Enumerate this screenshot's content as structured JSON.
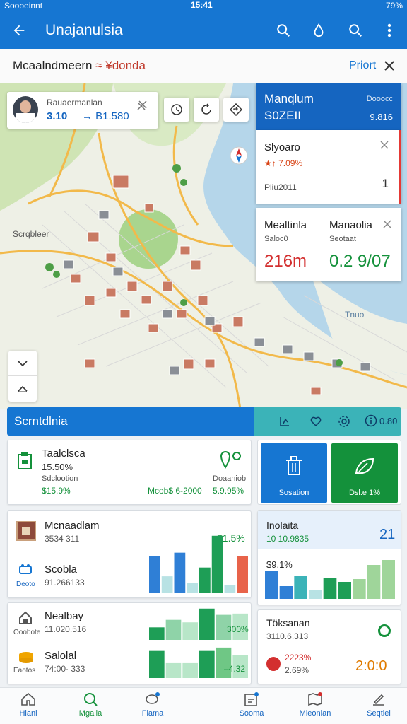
{
  "status": {
    "carrier": "Soooeinnt",
    "time": "15:41",
    "battery": "79%"
  },
  "appbar": {
    "title": "Unajanulsia"
  },
  "route": {
    "title": "Mcaalndmeern",
    "subtitle": "≈ ¥donda",
    "print_label": "Priort"
  },
  "profile": {
    "name": "Rauaermanlan",
    "stat_a": "3.10",
    "stat_b": "→ B1.580"
  },
  "info_header": {
    "title": "Manqlum",
    "sub": "S0ZEII",
    "right1": "Dooocc",
    "right2": "9.816"
  },
  "info_item1": {
    "title": "Slyoaro",
    "trend": "★↑ 7.09%",
    "desc": "Pliu2011",
    "count": "1"
  },
  "info_item2": {
    "label1": "Mealtinla",
    "label2": "Manaolia",
    "sub1": "Saloc0",
    "sub2": "Seotaat",
    "value1": "216m",
    "value2": "0.2 9/07"
  },
  "map_labels": {
    "town": "Scrqbleer",
    "water": "Tnuo"
  },
  "section": {
    "title": "Scrntdlnia",
    "icon_value": "0.80"
  },
  "card1": {
    "title": "Taalclsca",
    "pct": "15.50%",
    "sub": "Sdclootion",
    "sub2": "Doaaniob",
    "val1": "$15.9%",
    "val2": "Mcob$ 6-2000",
    "val3": "5.9.95%"
  },
  "action1": {
    "label": "Sosation"
  },
  "action2": {
    "label": "Dsl.e 1%"
  },
  "card2": {
    "row1_title": "Mcnaadlam",
    "row1_sub": "3534 311",
    "row1_value": "$1.5%",
    "row2_title": "Scobla",
    "row2_sub": "91.266133",
    "row2_icon_label": "Deoto",
    "bars": [
      55,
      25,
      60,
      15,
      38,
      85,
      12,
      55
    ]
  },
  "card3": {
    "title": "Inolaita",
    "sub": "10 10.9835",
    "num": "21",
    "pct": "$9.1%",
    "bars": [
      40,
      18,
      32,
      12,
      30,
      24,
      28,
      48,
      55
    ]
  },
  "card4": {
    "row1_title": "Nealbay",
    "row1_sub": "11.020.516",
    "row1_icon_label": "Ooobote",
    "row1_value": "300%",
    "row2_title": "Salolal",
    "row2_sub": "74:00· 333",
    "row2_icon_label": "Eaotos",
    "row2_value": "–4.32",
    "bars_top": [
      20,
      32,
      28,
      50,
      40,
      42
    ],
    "bars_bottom": [
      40,
      22,
      22,
      40,
      45,
      34
    ]
  },
  "card5": {
    "title": "Töksanan",
    "sub": "3110.6.313",
    "pct1": "2223%",
    "pct2": "2.69%",
    "value": "2:0:0"
  },
  "nav": [
    {
      "label": "Hianl",
      "icon": "home-icon"
    },
    {
      "label": "Mgalla",
      "icon": "search-icon"
    },
    {
      "label": "Fiama",
      "icon": "chat-icon"
    },
    {
      "label": "Sooma",
      "icon": "inbox-icon"
    },
    {
      "label": "Mleonlan",
      "icon": "map-icon"
    },
    {
      "label": "Seqtlel",
      "icon": "edit-icon"
    }
  ],
  "colors": {
    "primary": "#1676d2",
    "green": "#14913b",
    "red": "#d32f2f",
    "teal": "#3bb3b8"
  }
}
